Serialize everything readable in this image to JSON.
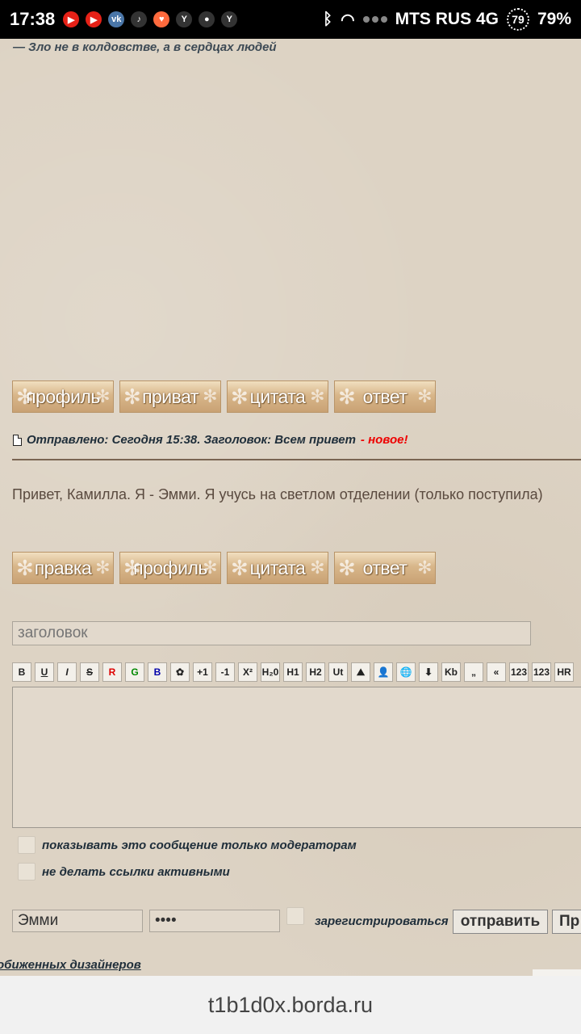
{
  "status_bar": {
    "time": "17:38",
    "apps": [
      {
        "icon": "youtube-icon",
        "glyph": "▶",
        "color": "#e62117"
      },
      {
        "icon": "youtube-icon",
        "glyph": "▶",
        "color": "#e62117"
      },
      {
        "icon": "vk-icon",
        "glyph": "vk",
        "color": "#4a76a8"
      },
      {
        "icon": "yandex-music-icon",
        "glyph": "♪",
        "color": "#ffffff"
      },
      {
        "icon": "heart-app-icon",
        "glyph": "♥",
        "color": "#ff6a3d"
      },
      {
        "icon": "yandex-icon",
        "glyph": "Y",
        "color": "#ffffff"
      },
      {
        "icon": "camera-app-icon",
        "glyph": "●",
        "color": "#ffffff"
      },
      {
        "icon": "yandex-icon",
        "glyph": "Y",
        "color": "#ffffff"
      }
    ],
    "carrier": "MTS RUS 4G",
    "battery_ring": "79",
    "battery": "79%"
  },
  "signature": "— Зло не в колдовстве, а в сердцах людей",
  "post_buttons_1": [
    "профиль",
    "приват",
    "цитата",
    "ответ"
  ],
  "post": {
    "header": "Отправлено: Сегодня 15:38. Заголовок: Всем привет",
    "new_label": "- новое!",
    "text": "Привет, Камилла. Я - Эмми. Я учусь на светлом отделении (только поступила)"
  },
  "post_buttons_2": [
    "правка",
    "профиль",
    "цитата",
    "ответ"
  ],
  "reply_form": {
    "title_placeholder": "заголовок",
    "toolbar": [
      "B",
      "U",
      "I",
      "S",
      "R",
      "G",
      "B",
      "✿",
      "+1",
      "-1",
      "X²",
      "H₂0",
      "H1",
      "H2",
      "Ut",
      "⛰",
      "👤",
      "🌐",
      "⬇",
      "Kb",
      "„",
      "«",
      "123",
      "123",
      "HR"
    ],
    "checkbox_moderators": "показывать это сообщение только модераторам",
    "checkbox_no_links": "не делать ссылки активными",
    "name_value": "Эмми",
    "password_value": "••••",
    "register_label": "зарегистрироваться",
    "send_button": "отправить",
    "preview_button": "Пр"
  },
  "footer_link": "обиженных дизайнеров",
  "url": "t1b1d0x.borda.ru"
}
